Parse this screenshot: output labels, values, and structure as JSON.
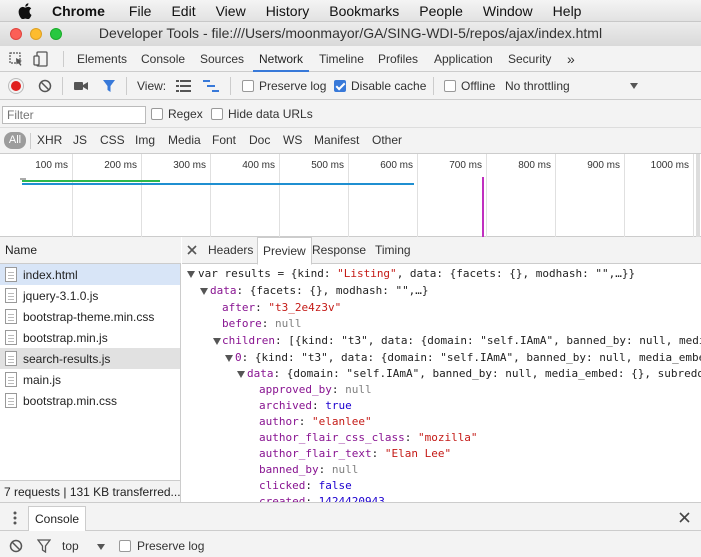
{
  "menubar": {
    "app": "Chrome",
    "items": [
      "File",
      "Edit",
      "View",
      "History",
      "Bookmarks",
      "People",
      "Window",
      "Help"
    ]
  },
  "window": {
    "title": "Developer Tools - file:///Users/moonmayor/GA/SING-WDI-5/repos/ajax/index.html"
  },
  "devtools_tabs": {
    "elements": "Elements",
    "console": "Console",
    "sources": "Sources",
    "network": "Network",
    "timeline": "Timeline",
    "profiles": "Profiles",
    "application": "Application",
    "security": "Security",
    "more": "»"
  },
  "network_toolbar": {
    "view_label": "View:",
    "preserve_log": "Preserve log",
    "disable_cache": "Disable cache",
    "offline": "Offline",
    "throttling": "No throttling"
  },
  "filter_bar": {
    "placeholder": "Filter",
    "regex": "Regex",
    "hide_data_urls": "Hide data URLs"
  },
  "type_filters": {
    "all": "All",
    "xhr": "XHR",
    "js": "JS",
    "css": "CSS",
    "img": "Img",
    "media": "Media",
    "font": "Font",
    "doc": "Doc",
    "ws": "WS",
    "manifest": "Manifest",
    "other": "Other"
  },
  "timeline": {
    "ticks": [
      "100 ms",
      "200 ms",
      "300 ms",
      "400 ms",
      "500 ms",
      "600 ms",
      "700 ms",
      "800 ms",
      "900 ms",
      "1000 ms"
    ]
  },
  "requests": {
    "header": "Name",
    "files": [
      "index.html",
      "jquery-3.1.0.js",
      "bootstrap-theme.min.css",
      "bootstrap.min.js",
      "search-results.js",
      "main.js",
      "bootstrap.min.css"
    ],
    "footer": "7 requests  |  131 KB transferred..."
  },
  "detail_tabs": {
    "headers": "Headers",
    "preview": "Preview",
    "response": "Response",
    "timing": "Timing"
  },
  "preview": {
    "l1_a": "var results = {kind: ",
    "l1_s": "\"Listing\"",
    "l1_b": ", data: {facets: {}, modhash: \"\",…}}",
    "l2_k": "data",
    "l2_b": ": {facets: {}, modhash: \"\",…}",
    "l3_k": "after",
    "l3_v": "\"t3_2e4z3v\"",
    "l4_k": "before",
    "l4_v": "null",
    "l5_k": "children",
    "l5_b": ": [{kind: \"t3\", data: {domain: \"self.IAmA\", banned_by: null, medi",
    "l6_k": "0",
    "l6_b": ": {kind: \"t3\", data: {domain: \"self.IAmA\", banned_by: null, media_embe",
    "l7_k": "data",
    "l7_b": ": {domain: \"self.IAmA\", banned_by: null, media_embed: {}, subredd",
    "f1_k": "approved_by",
    "f1_v": "null",
    "f2_k": "archived",
    "f2_v": "true",
    "f3_k": "author",
    "f3_v": "\"elanlee\"",
    "f4_k": "author_flair_css_class",
    "f4_v": "\"mozilla\"",
    "f5_k": "author_flair_text",
    "f5_v": "\"Elan Lee\"",
    "f6_k": "banned_by",
    "f6_v": "null",
    "f7_k": "clicked",
    "f7_v": "false",
    "f8_k": "created",
    "f8_v": "1424420943"
  },
  "drawer": {
    "console_tab": "Console",
    "context": "top",
    "preserve_log": "Preserve log"
  },
  "colors": {
    "accent": "#3879d9",
    "record": "#e0201f",
    "traffic_red": "#fc5f57",
    "traffic_yellow": "#fdbc2e",
    "traffic_green": "#28c840"
  }
}
